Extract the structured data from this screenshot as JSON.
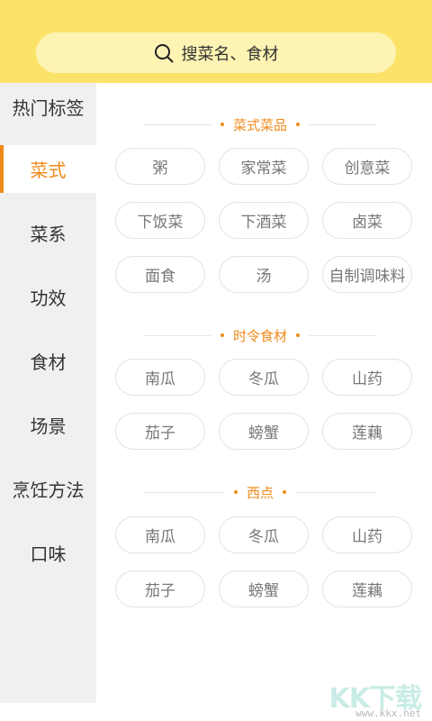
{
  "search": {
    "placeholder": "搜菜名、食材"
  },
  "sidebar": {
    "items": [
      {
        "label": "热门标签"
      },
      {
        "label": "菜式"
      },
      {
        "label": "菜系"
      },
      {
        "label": "功效"
      },
      {
        "label": "食材"
      },
      {
        "label": "场景"
      },
      {
        "label": "烹饪方法"
      },
      {
        "label": "口味"
      }
    ],
    "active_index": 1
  },
  "sections": [
    {
      "title": "菜式菜品",
      "tags": [
        "粥",
        "家常菜",
        "创意菜",
        "下饭菜",
        "下酒菜",
        "卤菜",
        "面食",
        "汤",
        "自制调味料"
      ]
    },
    {
      "title": "时令食材",
      "tags": [
        "南瓜",
        "冬瓜",
        "山药",
        "茄子",
        "螃蟹",
        "莲藕"
      ]
    },
    {
      "title": "西点",
      "tags": [
        "南瓜",
        "冬瓜",
        "山药",
        "茄子",
        "螃蟹",
        "莲藕"
      ]
    }
  ],
  "watermark": {
    "logo_text": "KK下载",
    "url": "www.kkx.net"
  },
  "colors": {
    "header_bg": "#fbe369",
    "accent": "#f08a1c",
    "sidebar_bg": "#f0f0f0",
    "tag_border": "#e3e3e3"
  }
}
